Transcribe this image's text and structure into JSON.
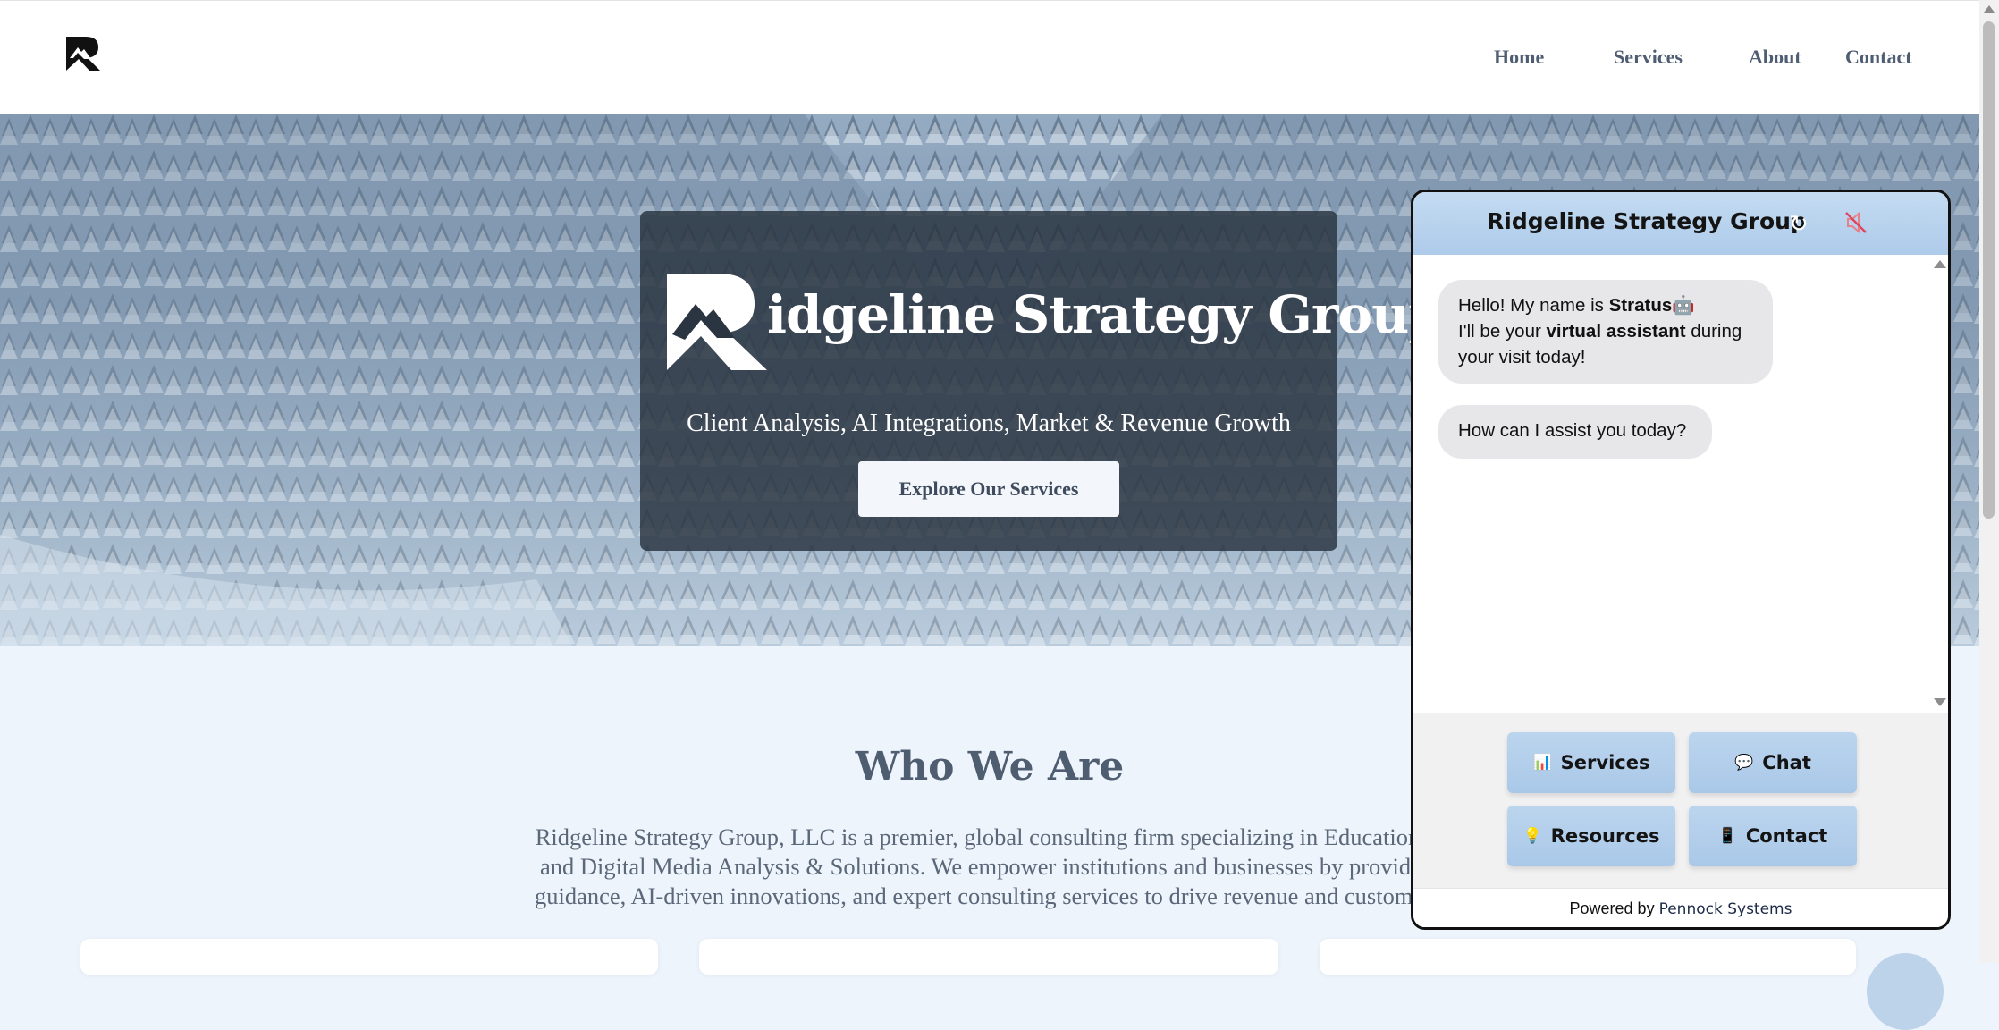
{
  "nav": {
    "logo_alt": "R",
    "items": [
      "Home",
      "Services",
      "About",
      "Contact"
    ]
  },
  "hero": {
    "title": "idgeline Strategy Group",
    "subtitle": "Client Analysis, AI Integrations, Market & Revenue Growth",
    "cta": "Explore Our Services"
  },
  "who": {
    "title": "Who We Are",
    "text_lines": [
      "Ridgeline Strategy Group, LLC is a premier, global consulting firm specializing in Education, T",
      "and Digital Media Analysis & Solutions. We empower institutions and businesses by providing",
      "guidance, AI-driven innovations, and expert consulting services to drive revenue and customer s"
    ]
  },
  "chat": {
    "title": "Ridgeline Strategy Group",
    "refresh_icon": "refresh-icon",
    "mute_icon": "muted-speaker-icon",
    "msg1": {
      "hello": "Hello! My name is ",
      "name": "Stratus",
      "line2a": "I'll be your ",
      "line2b": "virtual assistant",
      "line2c": " during",
      "line3": "your visit today!"
    },
    "msg2": "How can I assist you today?",
    "quick": [
      {
        "label": "Services",
        "icon": "📊"
      },
      {
        "label": "Chat",
        "icon": "💬"
      },
      {
        "label": "Resources",
        "icon": "💡"
      },
      {
        "label": "Contact",
        "icon": "📱"
      }
    ],
    "powered_prefix": "Powered by ",
    "powered_brand": "Pennock Systems"
  },
  "colors": {
    "nav_text": "#4f5d73",
    "chat_header": "#aecbea",
    "bubble": "#e7e7ea",
    "page_bg": "#eef4fc"
  }
}
